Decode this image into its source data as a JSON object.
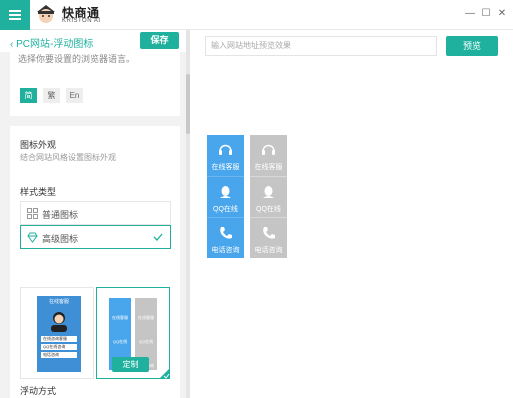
{
  "app": {
    "brand": "快商通",
    "brand_sub": "KRISTON AI",
    "window_controls": [
      "—",
      "☐",
      "✕"
    ]
  },
  "left": {
    "back_label": "PC网站-浮动图标",
    "save_label": "保存",
    "lang_desc": "选择你要设置的浏览器语言。",
    "lang_options": [
      "简",
      "繁",
      "En"
    ],
    "appearance_title": "图标外观",
    "appearance_desc": "结合网站风格设置图标外观",
    "style_type_title": "样式类型",
    "style_options": [
      "普通图标",
      "高级图标"
    ],
    "selected_style": "高级图标",
    "custom_label": "定制",
    "float_mode_title": "浮动方式",
    "thumb1_title": "在线客服",
    "thumb1_items": [
      "在线咨询客服",
      "QQ在线咨询",
      "电话咨询"
    ],
    "thumb2_items": [
      "在线客服",
      "QQ在线",
      "电话咨询"
    ]
  },
  "right": {
    "url_placeholder": "输入网站地址预览效果",
    "preview_label": "预览",
    "blue_items": [
      "在线客服",
      "QQ在线",
      "电话咨询"
    ],
    "gray_items": [
      "在线客服",
      "QQ在线",
      "电话咨询"
    ]
  },
  "colors": {
    "accent": "#1fb19e",
    "blue": "#4aa6ec",
    "gray": "#c5c5c5"
  }
}
